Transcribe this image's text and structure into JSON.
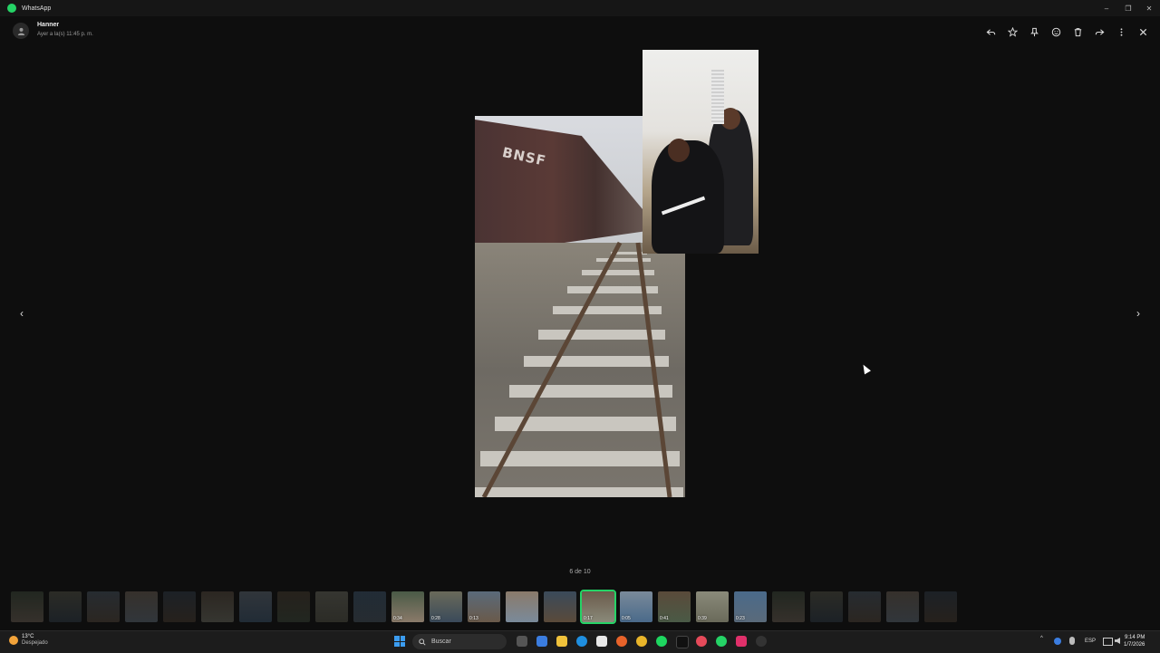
{
  "window": {
    "title": "WhatsApp",
    "controls": [
      "–",
      "❐",
      "✕"
    ]
  },
  "header": {
    "sender": "Hanner",
    "timestamp": "Ayer a la(s) 11:45 p. m.",
    "actions": [
      "reply-icon",
      "star-icon",
      "pin-icon",
      "emoji-icon",
      "delete-icon",
      "forward-icon",
      "more-icon",
      "close-icon"
    ]
  },
  "media": {
    "train_logo": "BNSF"
  },
  "navigation": {
    "prev": "‹",
    "next": "›",
    "counter": "6 de 10"
  },
  "thumbnails": [
    {
      "dim": true,
      "duration": ""
    },
    {
      "dim": true,
      "duration": ""
    },
    {
      "dim": true,
      "duration": ""
    },
    {
      "dim": true,
      "duration": ""
    },
    {
      "dim": true,
      "duration": ""
    },
    {
      "dim": true,
      "duration": ""
    },
    {
      "dim": true,
      "duration": ""
    },
    {
      "dim": true,
      "duration": ""
    },
    {
      "dim": true,
      "duration": ""
    },
    {
      "dim": true,
      "duration": ""
    },
    {
      "dim": false,
      "duration": "0:34"
    },
    {
      "dim": false,
      "duration": "0:28"
    },
    {
      "dim": false,
      "duration": "0:13"
    },
    {
      "dim": false,
      "duration": ""
    },
    {
      "dim": false,
      "duration": ""
    },
    {
      "dim": false,
      "duration": "0:17",
      "active": true
    },
    {
      "dim": false,
      "duration": "0:05"
    },
    {
      "dim": false,
      "duration": "0:41"
    },
    {
      "dim": false,
      "duration": "0:39"
    },
    {
      "dim": false,
      "duration": "0:23"
    },
    {
      "dim": true,
      "duration": ""
    },
    {
      "dim": true,
      "duration": ""
    },
    {
      "dim": true,
      "duration": ""
    },
    {
      "dim": true,
      "duration": ""
    },
    {
      "dim": true,
      "duration": ""
    }
  ],
  "taskbar": {
    "weather_temp": "13°C",
    "weather_desc": "Despejado",
    "search_placeholder": "Buscar",
    "language": "ESP",
    "time": "9:14 PM",
    "date": "1/7/2026"
  },
  "colors": {
    "accent": "#25d366",
    "background": "#0e0e0e"
  }
}
